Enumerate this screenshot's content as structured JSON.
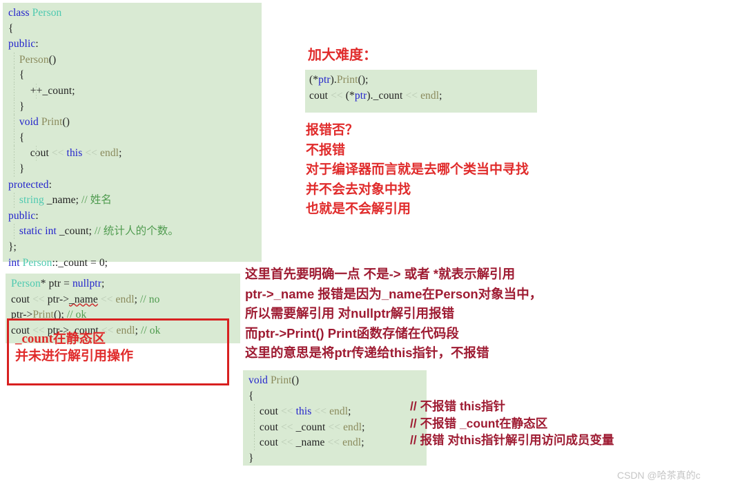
{
  "page": {
    "background": "#ffffff",
    "code_bg": "#d9ead3",
    "annotation_red": "#e02b2b",
    "annotation_dark_red": "#9e1b32",
    "box_red": "#d82020"
  },
  "class_block": {
    "name": "class-person-code-block",
    "lines": [
      {
        "tokens": [
          {
            "t": "class ",
            "c": "kw"
          },
          {
            "t": "Person",
            "c": "type"
          }
        ]
      },
      {
        "tokens": [
          {
            "t": "{",
            "c": "plain"
          }
        ]
      },
      {
        "tokens": [
          {
            "t": "public",
            "c": "kw"
          },
          {
            "t": ":",
            "c": "plain"
          }
        ]
      },
      {
        "guide": 1,
        "tokens": [
          {
            "t": "    ",
            "c": "plain"
          },
          {
            "t": "Person",
            "c": "fn"
          },
          {
            "t": "()",
            "c": "plain"
          }
        ]
      },
      {
        "guide": 1,
        "tokens": [
          {
            "t": "    {",
            "c": "plain"
          }
        ]
      },
      {
        "guide": 2,
        "tokens": [
          {
            "t": "        ++_count;",
            "c": "plain"
          }
        ]
      },
      {
        "guide": 1,
        "tokens": [
          {
            "t": "    }",
            "c": "plain"
          }
        ]
      },
      {
        "guide": 1,
        "tokens": [
          {
            "t": "    ",
            "c": "plain"
          },
          {
            "t": "void ",
            "c": "kw"
          },
          {
            "t": "Print",
            "c": "fn"
          },
          {
            "t": "()",
            "c": "plain"
          }
        ]
      },
      {
        "guide": 1,
        "tokens": [
          {
            "t": "    {",
            "c": "plain"
          }
        ]
      },
      {
        "guide": 2,
        "tokens": [
          {
            "t": "        cout ",
            "c": "plain"
          },
          {
            "t": "<< ",
            "c": "op"
          },
          {
            "t": "this",
            "c": "kw"
          },
          {
            "t": " << ",
            "c": "op"
          },
          {
            "t": "endl",
            "c": "fn"
          },
          {
            "t": ";",
            "c": "plain"
          }
        ]
      },
      {
        "guide": 1,
        "tokens": [
          {
            "t": "    }",
            "c": "plain"
          }
        ]
      },
      {
        "tokens": [
          {
            "t": "protected",
            "c": "kw"
          },
          {
            "t": ":",
            "c": "plain"
          }
        ]
      },
      {
        "guide": 1,
        "tokens": [
          {
            "t": "    ",
            "c": "plain"
          },
          {
            "t": "string",
            "c": "type"
          },
          {
            "t": " _name; ",
            "c": "plain"
          },
          {
            "t": "// 姓名",
            "c": "cmt"
          }
        ]
      },
      {
        "tokens": [
          {
            "t": "public",
            "c": "kw"
          },
          {
            "t": ":",
            "c": "plain"
          }
        ]
      },
      {
        "guide": 1,
        "tokens": [
          {
            "t": "    ",
            "c": "plain"
          },
          {
            "t": "static int",
            "c": "kw"
          },
          {
            "t": " _count; ",
            "c": "plain"
          },
          {
            "t": "// 统计人的个数。",
            "c": "cmt"
          }
        ]
      },
      {
        "tokens": [
          {
            "t": "};",
            "c": "plain"
          }
        ]
      },
      {
        "tokens": [
          {
            "t": "int ",
            "c": "kw"
          },
          {
            "t": "Person",
            "c": "type"
          },
          {
            "t": "::_count = 0;",
            "c": "plain"
          }
        ]
      }
    ]
  },
  "ptr_block": {
    "name": "ptr-usage-code-block",
    "lines": [
      {
        "tokens": [
          {
            "t": "Person",
            "c": "type"
          },
          {
            "t": "* ptr = ",
            "c": "plain"
          },
          {
            "t": "nullptr",
            "c": "kw"
          },
          {
            "t": ";",
            "c": "plain"
          }
        ]
      },
      {
        "tokens": [
          {
            "t": "cout ",
            "c": "plain"
          },
          {
            "t": "<< ",
            "c": "op"
          },
          {
            "t": "ptr->",
            "c": "plain"
          },
          {
            "t": "_name",
            "c": "sq"
          },
          {
            "t": " << ",
            "c": "op"
          },
          {
            "t": "endl",
            "c": "fn"
          },
          {
            "t": "; ",
            "c": "plain"
          },
          {
            "t": "// no",
            "c": "cmt"
          }
        ]
      },
      {
        "tokens": [
          {
            "t": "ptr->",
            "c": "plain"
          },
          {
            "t": "Print",
            "c": "fn"
          },
          {
            "t": "(); ",
            "c": "plain"
          },
          {
            "t": "// ok",
            "c": "cmt"
          }
        ]
      },
      {
        "tokens": [
          {
            "t": "cout ",
            "c": "plain"
          },
          {
            "t": "<< ",
            "c": "op"
          },
          {
            "t": "ptr->_count ",
            "c": "plain"
          },
          {
            "t": "<< ",
            "c": "op"
          },
          {
            "t": "endl",
            "c": "fn"
          },
          {
            "t": "; ",
            "c": "plain"
          },
          {
            "t": "// ok",
            "c": "cmt"
          }
        ]
      }
    ]
  },
  "deref_block": {
    "name": "deref-print-code-block",
    "lines": [
      {
        "tokens": [
          {
            "t": "(*",
            "c": "plain"
          },
          {
            "t": "ptr",
            "c": "kw"
          },
          {
            "t": ").",
            "c": "plain"
          },
          {
            "t": "Print",
            "c": "fn"
          },
          {
            "t": "();",
            "c": "plain"
          }
        ]
      },
      {
        "tokens": [
          {
            "t": "cout ",
            "c": "plain"
          },
          {
            "t": "<< ",
            "c": "op"
          },
          {
            "t": "(*",
            "c": "plain"
          },
          {
            "t": "ptr",
            "c": "kw"
          },
          {
            "t": ")._count ",
            "c": "plain"
          },
          {
            "t": "<< ",
            "c": "op"
          },
          {
            "t": "endl",
            "c": "fn"
          },
          {
            "t": ";",
            "c": "plain"
          }
        ]
      }
    ]
  },
  "print_block": {
    "name": "print-method-code-block",
    "lines": [
      {
        "tokens": [
          {
            "t": "void ",
            "c": "kw"
          },
          {
            "t": "Print",
            "c": "fn"
          },
          {
            "t": "()",
            "c": "plain"
          }
        ]
      },
      {
        "tokens": [
          {
            "t": "{",
            "c": "plain"
          }
        ]
      },
      {
        "guide": 1,
        "tokens": [
          {
            "t": "    cout ",
            "c": "plain"
          },
          {
            "t": "<< ",
            "c": "op"
          },
          {
            "t": "this",
            "c": "kw"
          },
          {
            "t": " << ",
            "c": "op"
          },
          {
            "t": "endl",
            "c": "fn"
          },
          {
            "t": ";",
            "c": "plain"
          }
        ]
      },
      {
        "guide": 1,
        "tokens": [
          {
            "t": "    cout ",
            "c": "plain"
          },
          {
            "t": "<< ",
            "c": "op"
          },
          {
            "t": "_count ",
            "c": "plain"
          },
          {
            "t": "<< ",
            "c": "op"
          },
          {
            "t": "endl",
            "c": "fn"
          },
          {
            "t": ";",
            "c": "plain"
          }
        ]
      },
      {
        "guide": 1,
        "tokens": [
          {
            "t": "    cout ",
            "c": "plain"
          },
          {
            "t": "<< ",
            "c": "op"
          },
          {
            "t": "_name ",
            "c": "plain"
          },
          {
            "t": "<< ",
            "c": "op"
          },
          {
            "t": "endl",
            "c": "fn"
          },
          {
            "t": ";",
            "c": "plain"
          }
        ]
      },
      {
        "tokens": [
          {
            "t": "}",
            "c": "plain"
          }
        ]
      }
    ]
  },
  "annotations": {
    "harder_title": "加大难度：",
    "question_lines": [
      "报错否？",
      "不报错",
      "对于编译器而言就是去哪个类当中寻找",
      "并不会去对象中找",
      "也就是不会解引用"
    ],
    "redbox_note_lines": [
      "_count在静态区",
      "并未进行解引用操作"
    ],
    "explanation_lines": [
      "这里首先要明确一点 不是-> 或者 *就表示解引用",
      "ptr->_name 报错是因为_name在Person对象当中，",
      "所以需要解引用 对nullptr解引用报错",
      "而ptr->Print() Print函数存储在代码段",
      "这里的意思是将ptr传递给this指针，不报错"
    ],
    "print_comments": [
      "// 不报错 this指针",
      "// 不报错 _count在静态区",
      "// 报错 对this指针解引用访问成员变量"
    ]
  },
  "watermark": {
    "text": "CSDN @哈茶真的c"
  }
}
